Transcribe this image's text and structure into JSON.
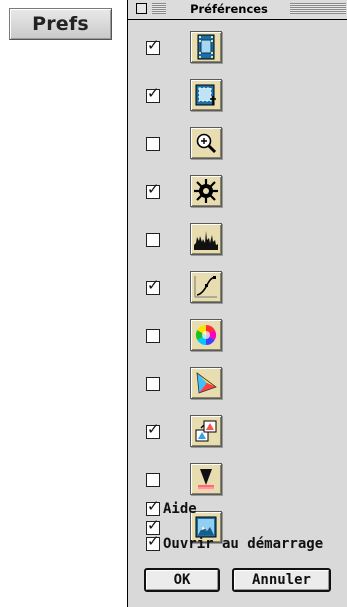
{
  "external": {
    "prefs_label": "Prefs"
  },
  "window": {
    "title": "Préférences",
    "tools": [
      {
        "icon": "film-frame-icon",
        "checked": true
      },
      {
        "icon": "crop-select-icon",
        "checked": true
      },
      {
        "icon": "magnifier-icon",
        "checked": false
      },
      {
        "icon": "aperture-icon",
        "checked": true
      },
      {
        "icon": "histogram-icon",
        "checked": false
      },
      {
        "icon": "curve-icon",
        "checked": true
      },
      {
        "icon": "color-wheel-icon",
        "checked": false
      },
      {
        "icon": "gamut-triangle-icon",
        "checked": false
      },
      {
        "icon": "color-profile-icon",
        "checked": true
      },
      {
        "icon": "density-wedge-icon",
        "checked": false
      },
      {
        "icon": "landscape-image-icon",
        "checked": true
      }
    ],
    "check_mark": "✓",
    "options": [
      {
        "label": "Aide",
        "checked": true
      },
      {
        "label": "Ouvrir au démarrage",
        "checked": true
      }
    ],
    "ok_label": "OK",
    "cancel_label": "Annuler"
  }
}
